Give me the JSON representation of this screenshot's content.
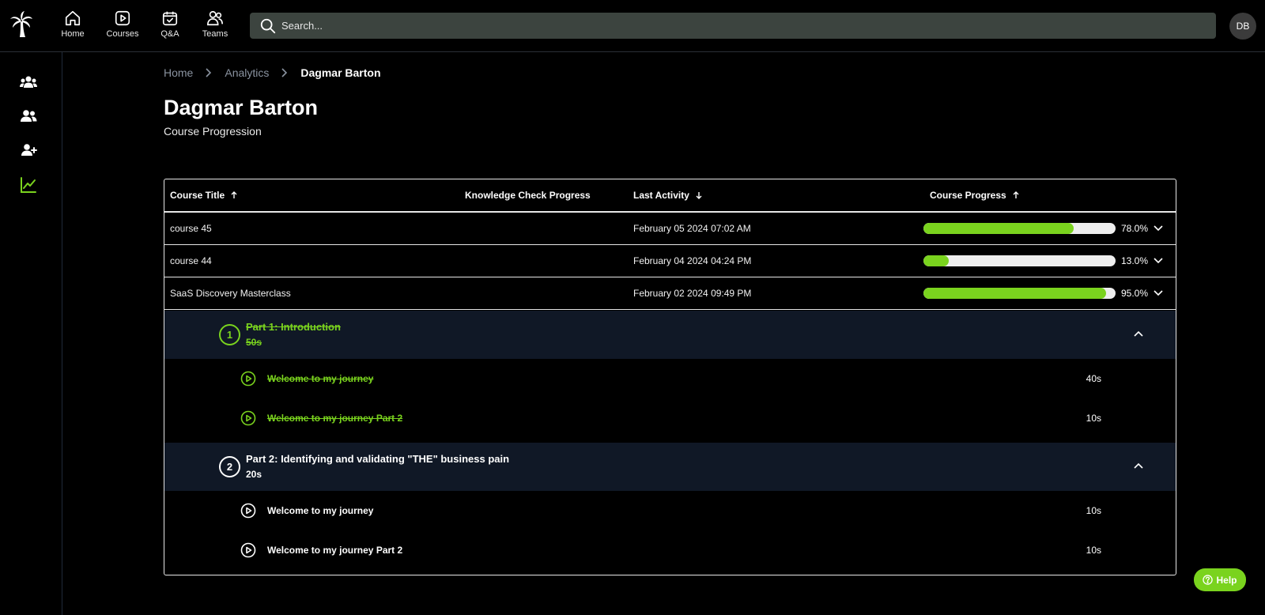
{
  "nav": {
    "items": [
      {
        "label": "Home",
        "icon": "home-icon"
      },
      {
        "label": "Courses",
        "icon": "play-square-icon"
      },
      {
        "label": "Q&A",
        "icon": "calendar-check-icon"
      },
      {
        "label": "Teams",
        "icon": "users-icon"
      }
    ]
  },
  "search": {
    "placeholder": "Search..."
  },
  "user": {
    "initials": "DB"
  },
  "sidebar": {
    "items": [
      {
        "icon": "groups-icon"
      },
      {
        "icon": "users-icon"
      },
      {
        "icon": "add-user-icon"
      },
      {
        "icon": "analytics-icon",
        "active": true
      }
    ]
  },
  "breadcrumb": [
    "Home",
    "Analytics",
    "Dagmar Barton"
  ],
  "page": {
    "title": "Dagmar Barton",
    "subtitle": "Course Progression"
  },
  "table": {
    "columns": [
      {
        "label": "Course Title",
        "sort": "asc"
      },
      {
        "label": "Knowledge Check Progress",
        "sort": ""
      },
      {
        "label": "Last Activity",
        "sort": "desc"
      },
      {
        "label": "Course Progress",
        "sort": "asc"
      }
    ],
    "rows": [
      {
        "title": "course 45",
        "knowledge": "",
        "last_activity": "February 05 2024 07:02 AM",
        "progress": 78,
        "progress_label": "78.0%"
      },
      {
        "title": "course 44",
        "knowledge": "",
        "last_activity": "February 04 2024 04:24 PM",
        "progress": 13,
        "progress_label": "13.0%"
      },
      {
        "title": "SaaS Discovery Masterclass",
        "knowledge": "",
        "last_activity": "February 02 2024 09:49 PM",
        "progress": 95,
        "progress_label": "95.0%"
      }
    ],
    "expanded": {
      "sections": [
        {
          "number": "1",
          "title": "Part 1: Introduction",
          "duration": "50s",
          "completed": true,
          "lessons": [
            {
              "title": "Welcome to my journey",
              "duration": "40s",
              "completed": true
            },
            {
              "title": "Welcome to my journey Part 2",
              "duration": "10s",
              "completed": true
            }
          ]
        },
        {
          "number": "2",
          "title": "Part 2: Identifying and validating \"THE\" business pain",
          "duration": "20s",
          "completed": false,
          "lessons": [
            {
              "title": "Welcome to my journey",
              "duration": "10s",
              "completed": false
            },
            {
              "title": "Welcome to my journey Part 2",
              "duration": "10s",
              "completed": false
            }
          ]
        }
      ]
    }
  },
  "help": {
    "label": "Help"
  },
  "colors": {
    "accent": "#7ad31e",
    "background": "#000000",
    "section_bg": "#101826",
    "search_bg": "#3c443f"
  }
}
